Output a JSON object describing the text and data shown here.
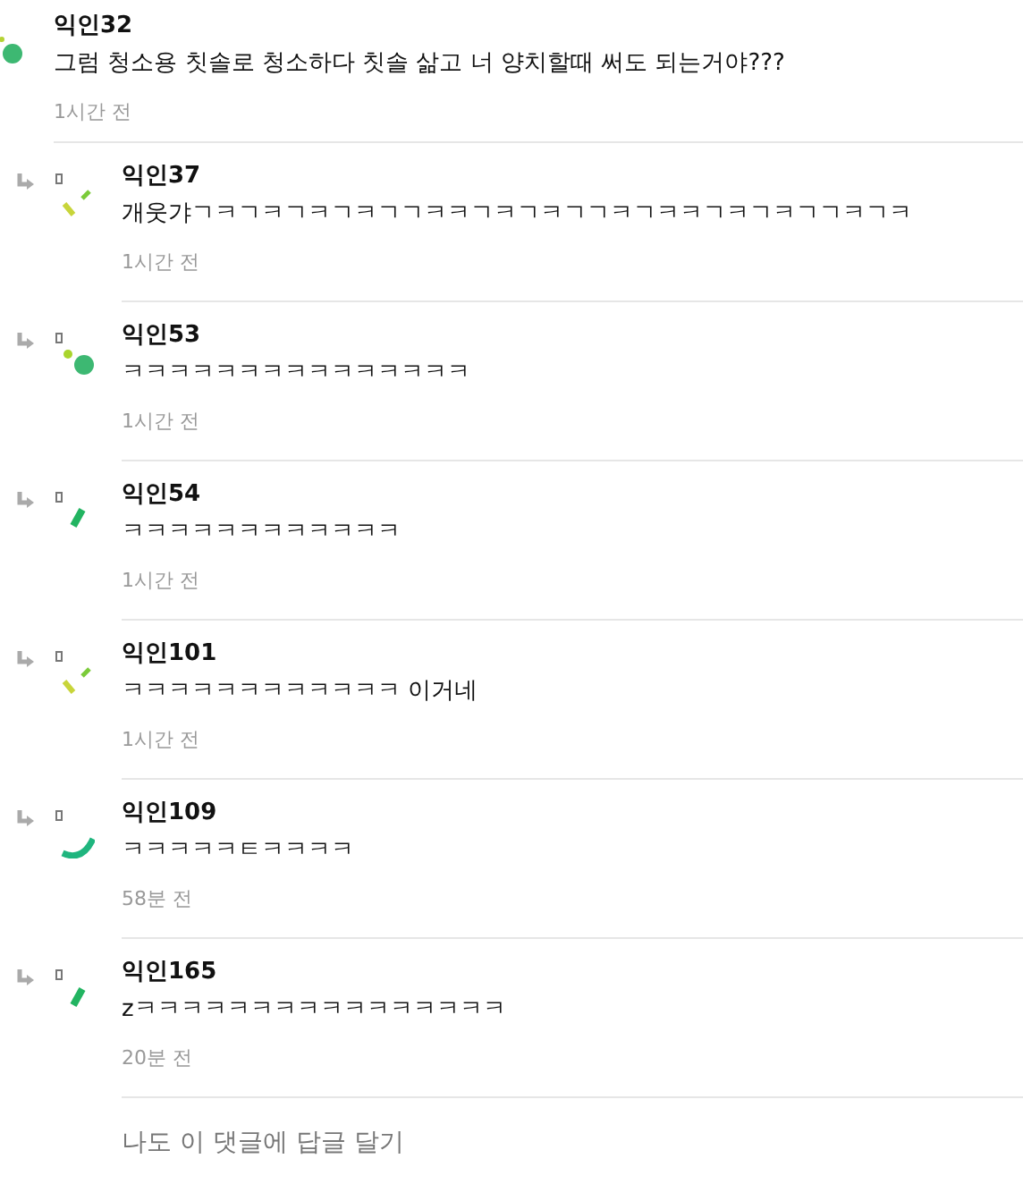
{
  "comment": {
    "author": "익인32",
    "text": "그럼 청소용 칫솔로 청소하다 칫솔 삶고 너 양치할때 써도 되는거야???",
    "time": "1시간 전"
  },
  "replies": [
    {
      "author": "익인37",
      "text": "개웃갸ㄱㅋㄱㅋㄱㅋㄱㅋㄱㄱㅋㅋㄱㅋㄱㅋㄱㄱㅋㄱㅋㅋㄱㅋㄱㅋㄱㄱㅋㄱㅋ",
      "time": "1시간 전"
    },
    {
      "author": "익인53",
      "text": "ㅋㅋㅋㅋㅋㅋㅋㅋㅋㅋㅋㅋㅋㅋㅋ",
      "time": "1시간 전"
    },
    {
      "author": "익인54",
      "text": "ㅋㅋㅋㅋㅋㅋㅋㅋㅋㅋㅋㅋ",
      "time": "1시간 전"
    },
    {
      "author": "익인101",
      "text": "ㅋㅋㅋㅋㅋㅋㅋㅋㅋㅋㅋㅋ 이거네",
      "time": "1시간 전"
    },
    {
      "author": "익인109",
      "text": "ㅋㅋㅋㅋㅋㅌㅋㅋㅋㅋ",
      "time": "58분 전"
    },
    {
      "author": "익인165",
      "text": "zㅋㅋㅋㅋㅋㅋㅋㅋㅋㅋㅋㅋㅋㅋㅋㅋ",
      "time": "20분 전"
    }
  ],
  "reply_prompt": "나도 이 댓글에 답글 달기"
}
